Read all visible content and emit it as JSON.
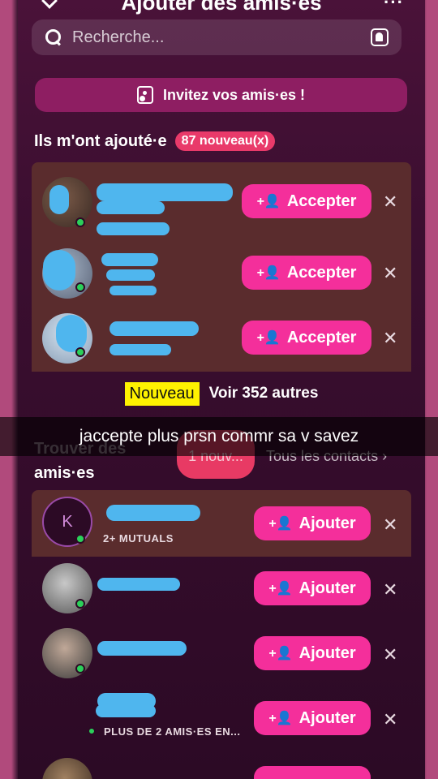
{
  "header": {
    "title": "Ajouter des amis·es"
  },
  "search": {
    "placeholder": "Recherche..."
  },
  "invite": {
    "label": "Invitez vos amis·es !"
  },
  "added_me": {
    "title": "Ils m'ont ajouté·e",
    "badge": "87 nouveau(x)",
    "rows": [
      {
        "button": "Accepter"
      },
      {
        "button": "Accepter"
      },
      {
        "button": "Accepter"
      }
    ],
    "new_tag": "Nouveau",
    "see_more": "Voir 352 autres"
  },
  "caption": "jaccepte plus prsn commr sa v savez",
  "find": {
    "title_line1": "Trouver des",
    "title_line2": "amis·es",
    "new_pill": "1 nouv...",
    "all_contacts": "Tous les contacts ›",
    "rows": [
      {
        "initial": "K",
        "sub": "2+ MUTUALS",
        "button": "Ajouter"
      },
      {
        "sub": "",
        "button": "Ajouter"
      },
      {
        "sub": "",
        "button": "Ajouter"
      },
      {
        "sub": "PLUS DE 2 AMIS·ES EN...",
        "button": "Ajouter"
      }
    ]
  },
  "colors": {
    "accent": "#f42f9b",
    "badge": "#e93a6a",
    "highlight": "#fff200",
    "online": "#2bd05a"
  }
}
